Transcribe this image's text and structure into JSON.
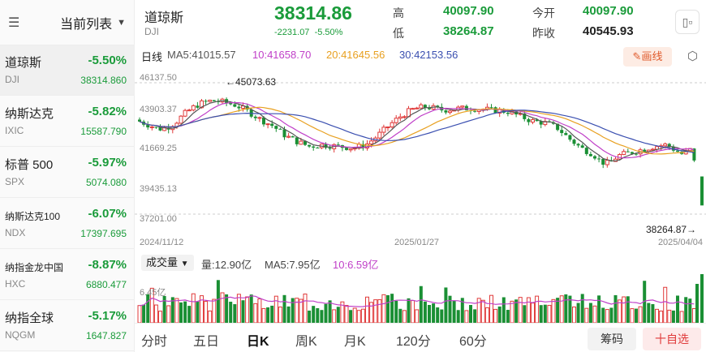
{
  "sidebar": {
    "title": "当前列表",
    "items": [
      {
        "name": "道琼斯",
        "code": "DJI",
        "pct": "-5.50%",
        "price": "38314.860",
        "small": false
      },
      {
        "name": "纳斯达克",
        "code": "IXIC",
        "pct": "-5.82%",
        "price": "15587.790",
        "small": false
      },
      {
        "name": "标普 500",
        "code": "SPX",
        "pct": "-5.97%",
        "price": "5074.080",
        "small": false
      },
      {
        "name": "纳斯达克100",
        "code": "NDX",
        "pct": "-6.07%",
        "price": "17397.695",
        "small": true
      },
      {
        "name": "纳指金龙中国",
        "code": "HXC",
        "pct": "-8.87%",
        "price": "6880.477",
        "small": true
      },
      {
        "name": "纳指全球",
        "code": "NQGM",
        "pct": "-5.17%",
        "price": "1647.827",
        "small": false
      }
    ]
  },
  "quote": {
    "name": "道琼斯",
    "code": "DJI",
    "price": "38314.86",
    "change": "-2231.07",
    "change_pct": "-5.50%",
    "high_label": "高",
    "high": "40097.90",
    "low_label": "低",
    "low": "38264.87",
    "open_label": "今开",
    "open": "40097.90",
    "prev_label": "昨收",
    "prev": "40545.93"
  },
  "chart": {
    "period": "日线",
    "ma5": "MA5:41015.57",
    "ma10": "10:41658.70",
    "ma20": "20:41645.56",
    "ma30": "30:42153.56",
    "draw_label": "画线",
    "y_labels": [
      "46137.50",
      "43903.37",
      "41669.25",
      "39435.13",
      "37201.00"
    ],
    "max_marker": "←45073.63",
    "min_marker": "38264.87→",
    "x_labels": [
      "2024/11/12",
      "2025/01/27",
      "2025/04/04"
    ],
    "colors": {
      "up": "#e03a3a",
      "down": "#1a8f34",
      "ma5": "#555555",
      "ma10": "#c040c8",
      "ma20": "#e8a020",
      "ma30": "#3a4fb0"
    }
  },
  "volume": {
    "selector": "成交量",
    "vol": "量:12.90亿",
    "ma5": "MA5:7.95亿",
    "ma10": "10:6.59亿",
    "y_label": "6.45亿"
  },
  "tabs": [
    "分时",
    "五日",
    "日K",
    "周K",
    "月K",
    "120分",
    "60分"
  ],
  "active_tab": "日K",
  "buttons": {
    "chips": "筹码",
    "watch": "十自选"
  }
}
